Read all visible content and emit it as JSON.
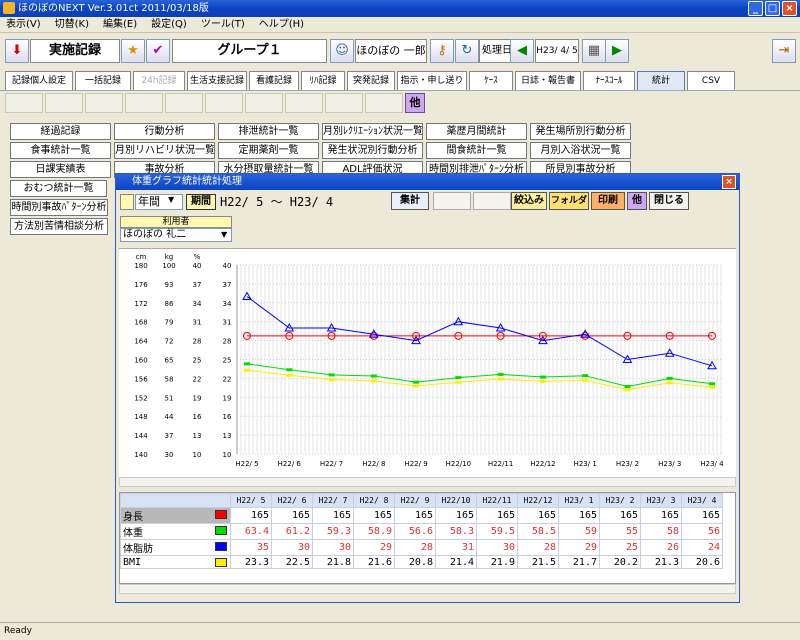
{
  "window": {
    "title": "ほのぼのNEXT  Ver.3.01ct     2011/03/18版"
  },
  "menu": [
    "表示(V)",
    "切替(K)",
    "編集(E)",
    "設定(Q)",
    "ツール(T)",
    "ヘルプ(H)"
  ],
  "toolbar": {
    "section": "実施記録",
    "group": "グループ１",
    "user": "ほのぼの 一郎",
    "process_label": "処理日",
    "date": "H23/ 4/ 5"
  },
  "tabs": [
    "記録個人設定",
    "一括記録",
    "24h記録",
    "生活支援記録",
    "看護記録",
    "ﾘﾊ記録",
    "突発記録",
    "指示・申し送り",
    "ｹｰｽ",
    "日誌・報告書",
    "ﾅｰｽｺｰﾙ",
    "統計",
    "CSV"
  ],
  "other_label": "他",
  "functions": [
    [
      "経過記録",
      "行動分析",
      "排泄統計一覧",
      "月別ﾚｸﾘｴｰｼｮﾝ状況一覧",
      "薬歴月間統計",
      "発生場所別行動分析"
    ],
    [
      "食事統計一覧",
      "月別リハビリ状況一覧",
      "定期薬剤一覧",
      "発生状況別行動分析",
      "間食統計一覧",
      "月別入浴状況一覧"
    ],
    [
      "日課実績表",
      "事故分析",
      "水分摂取量統計一覧",
      "ADL評価状況",
      "時間別排泄ﾊﾟﾀｰﾝ分析",
      "所見別事故分析"
    ],
    [
      "おむつ統計一覧"
    ],
    [
      "時間別事故ﾊﾟﾀｰﾝ分析"
    ],
    [
      "方法別苦情相談分析"
    ]
  ],
  "dialog": {
    "title": "体重グラフ統計統計処理",
    "period_unit": "年間",
    "period_btn": "期間",
    "period_range": "H22/ 5 ～ H23/ 4",
    "aggregate": "集計",
    "filter": "絞込み",
    "folder": "フォルダ",
    "print": "印刷",
    "other": "他",
    "close": "閉じる",
    "user_label": "利用者",
    "user_name": "ほのぼの 礼二"
  },
  "axes": {
    "cm_unit": "cm",
    "kg_unit": "kg",
    "pct_unit": "%",
    "cm": [
      "180",
      "176",
      "172",
      "168",
      "164",
      "160",
      "156",
      "152",
      "148",
      "144",
      "140"
    ],
    "kg": [
      "100",
      "93",
      "86",
      "79",
      "72",
      "65",
      "58",
      "51",
      "44",
      "37",
      "30"
    ],
    "pct": [
      "40",
      "37",
      "34",
      "31",
      "28",
      "25",
      "22",
      "19",
      "16",
      "13",
      "10"
    ],
    "bmi": [
      "40",
      "37",
      "34",
      "31",
      "28",
      "25",
      "22",
      "19",
      "16",
      "13",
      "10"
    ]
  },
  "chart_data": {
    "type": "line",
    "x": [
      "H22/ 5",
      "H22/ 6",
      "H22/ 7",
      "H22/ 8",
      "H22/ 9",
      "H22/10",
      "H22/11",
      "H22/12",
      "H23/ 1",
      "H23/ 2",
      "H23/ 3",
      "H23/ 4"
    ],
    "series": [
      {
        "name": "身長",
        "values": [
          165,
          165,
          165,
          165,
          165,
          165,
          165,
          165,
          165,
          165,
          165,
          165
        ],
        "color": "#ff0000"
      },
      {
        "name": "体重",
        "values": [
          63.4,
          61.2,
          59.3,
          58.9,
          56.6,
          58.3,
          59.5,
          58.5,
          59,
          55,
          58,
          56
        ],
        "color": "#00dd00"
      },
      {
        "name": "体脂肪",
        "values": [
          35,
          30,
          30,
          29,
          28,
          31,
          30,
          28,
          29,
          25,
          26,
          24
        ],
        "color": "#0000ff"
      },
      {
        "name": "BMI",
        "values": [
          23.3,
          22.5,
          21.8,
          21.6,
          20.8,
          21.4,
          21.9,
          21.5,
          21.7,
          20.2,
          21.3,
          20.6
        ],
        "color": "#ffee00"
      }
    ],
    "ylim_cm": [
      140,
      180
    ],
    "ylim_kg": [
      30,
      100
    ],
    "ylim_pct": [
      10,
      40
    ],
    "ylim_bmi": [
      10,
      40
    ],
    "grid": true
  },
  "table": {
    "headers": [
      "H22/ 5",
      "H22/ 6",
      "H22/ 7",
      "H22/ 8",
      "H22/ 9",
      "H22/10",
      "H22/11",
      "H22/12",
      "H23/ 1",
      "H23/ 2",
      "H23/ 3",
      "H23/ 4"
    ],
    "rows": [
      {
        "label": "身長",
        "values": [
          "165",
          "165",
          "165",
          "165",
          "165",
          "165",
          "165",
          "165",
          "165",
          "165",
          "165",
          "165"
        ],
        "swatch": "#ff0000",
        "text_color": "#000000"
      },
      {
        "label": "体重",
        "values": [
          "63.4",
          "61.2",
          "59.3",
          "58.9",
          "56.6",
          "58.3",
          "59.5",
          "58.5",
          "59",
          "55",
          "58",
          "56"
        ],
        "swatch": "#00dd00",
        "text_color": "#e03030"
      },
      {
        "label": "体脂肪",
        "values": [
          "35",
          "30",
          "30",
          "29",
          "28",
          "31",
          "30",
          "28",
          "29",
          "25",
          "26",
          "24"
        ],
        "swatch": "#0000ff",
        "text_color": "#e03030"
      },
      {
        "label": "BMI",
        "values": [
          "23.3",
          "22.5",
          "21.8",
          "21.6",
          "20.8",
          "21.4",
          "21.9",
          "21.5",
          "21.7",
          "20.2",
          "21.3",
          "20.6"
        ],
        "swatch": "#ffee00",
        "text_color": "#000000"
      }
    ]
  },
  "status": "Ready"
}
